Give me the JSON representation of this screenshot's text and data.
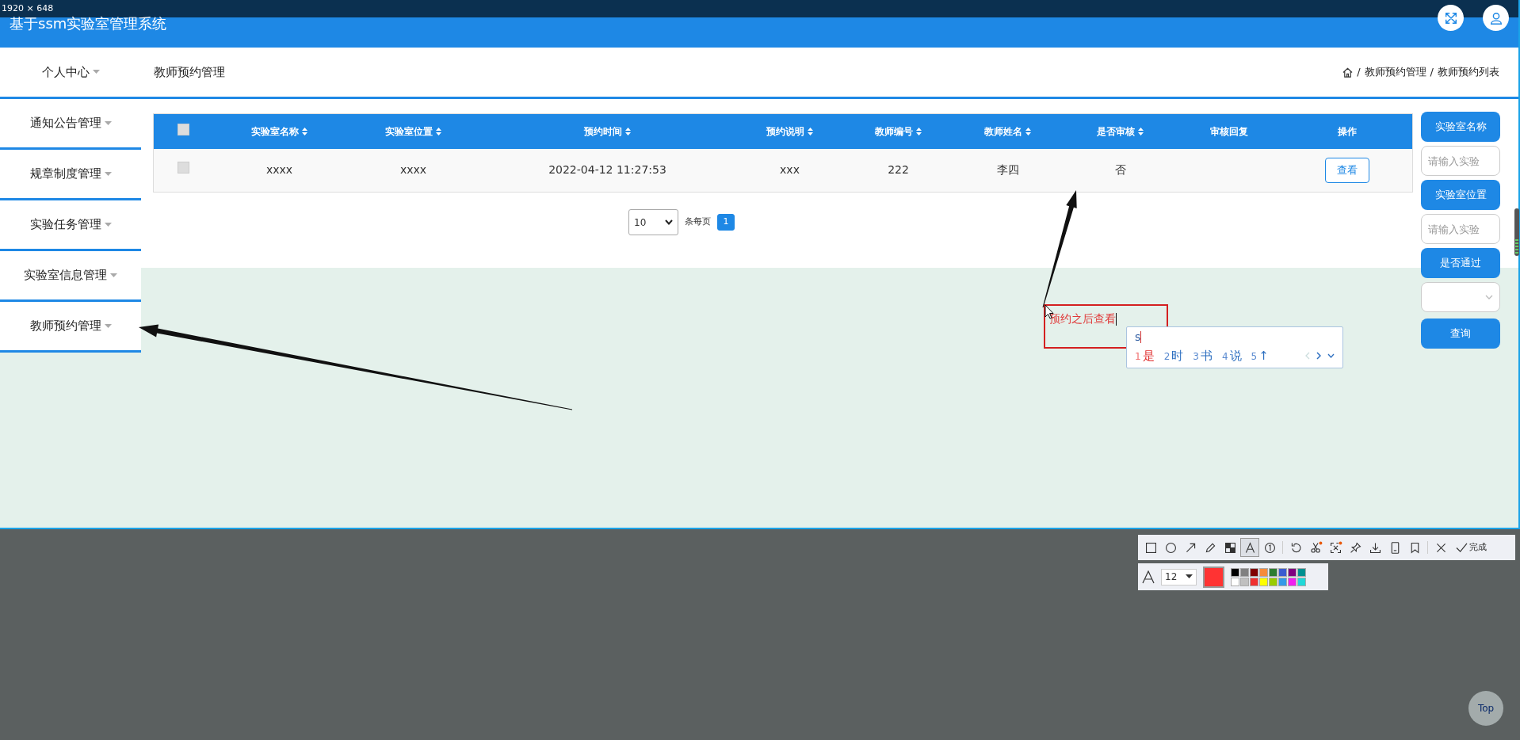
{
  "capture_bar": {
    "size": "1920 × 648"
  },
  "header": {
    "title": "基于ssm实验室管理系统"
  },
  "nav": {
    "menu": "个人中心",
    "page_title": "教师预约管理",
    "breadcrumb": [
      "/",
      "教师预约管理",
      "/",
      "教师预约列表"
    ]
  },
  "sidebar": {
    "items": [
      {
        "label": "通知公告管理"
      },
      {
        "label": "规章制度管理"
      },
      {
        "label": "实验任务管理"
      },
      {
        "label": "实验室信息管理"
      },
      {
        "label": "教师预约管理"
      }
    ]
  },
  "table": {
    "header_checked": false,
    "columns": [
      {
        "label": "实验室名称",
        "sortable": true
      },
      {
        "label": "实验室位置",
        "sortable": true
      },
      {
        "label": "预约时间",
        "sortable": true
      },
      {
        "label": "预约说明",
        "sortable": true
      },
      {
        "label": "教师编号",
        "sortable": true
      },
      {
        "label": "教师姓名",
        "sortable": true
      },
      {
        "label": "是否审核",
        "sortable": true
      },
      {
        "label": "审核回复",
        "sortable": false
      },
      {
        "label": "操作",
        "sortable": false
      }
    ],
    "rows": [
      {
        "checked": false,
        "values": [
          "xxxx",
          "xxxx",
          "2022-04-12 11:27:53",
          "xxx",
          "222",
          "李四",
          "否"
        ],
        "action": "查看"
      }
    ]
  },
  "pagination": {
    "page_size": "10",
    "unit": "条每页",
    "pages": [
      {
        "label": "1",
        "selected": true
      }
    ]
  },
  "filters": [
    {
      "kind": "button",
      "label": "实验室名称"
    },
    {
      "kind": "input",
      "placeholder": "请输入实验"
    },
    {
      "kind": "button",
      "label": "实验室位置"
    },
    {
      "kind": "input",
      "placeholder": "请输入实验"
    },
    {
      "kind": "button",
      "label": "是否通过"
    },
    {
      "kind": "select"
    },
    {
      "kind": "search",
      "label": "查询"
    }
  ],
  "annotation": {
    "text": "预约之后查看"
  },
  "ime": {
    "input": "s",
    "candidates": [
      {
        "index": "1",
        "text": "是",
        "selected": true
      },
      {
        "index": "2",
        "text": "时",
        "selected": false
      },
      {
        "index": "3",
        "text": "书",
        "selected": false
      },
      {
        "index": "4",
        "text": "说",
        "selected": false
      },
      {
        "index": "5",
        "text": "↑",
        "selected": false
      }
    ]
  },
  "toolbar": {
    "tools": [
      {
        "kind": "rect",
        "selected": false
      },
      {
        "kind": "ellipse",
        "selected": false
      },
      {
        "kind": "arrow",
        "selected": false
      },
      {
        "kind": "pencil",
        "selected": false
      },
      {
        "kind": "mosaic",
        "selected": false
      },
      {
        "kind": "text",
        "selected": true
      },
      {
        "kind": "number",
        "selected": false
      },
      {
        "kind": "sep"
      },
      {
        "kind": "undo",
        "selected": false
      },
      {
        "kind": "cut",
        "selected": false
      },
      {
        "kind": "scan",
        "selected": false
      },
      {
        "kind": "pin",
        "selected": false
      },
      {
        "kind": "save",
        "selected": false
      },
      {
        "kind": "phone",
        "selected": false
      },
      {
        "kind": "bookmark",
        "selected": false
      },
      {
        "kind": "sep"
      },
      {
        "kind": "cancel",
        "selected": false
      }
    ],
    "done": "完成"
  },
  "style_bar": {
    "size": "12",
    "current": {
      "color": "#ff3333"
    },
    "palette": [
      {
        "color": "#000000"
      },
      {
        "color": "#808080"
      },
      {
        "color": "#800000"
      },
      {
        "color": "#f68b3a"
      },
      {
        "color": "#2e7d32"
      },
      {
        "color": "#3a5bd0"
      },
      {
        "color": "#800080"
      },
      {
        "color": "#009090"
      },
      {
        "color": "#ffffff"
      },
      {
        "color": "#c0c0c0"
      },
      {
        "color": "#f03030"
      },
      {
        "color": "#ffff00"
      },
      {
        "color": "#99cc00"
      },
      {
        "color": "#3399e8"
      },
      {
        "color": "#f020f0"
      },
      {
        "color": "#20d8d8"
      }
    ]
  },
  "top_button": "Top"
}
